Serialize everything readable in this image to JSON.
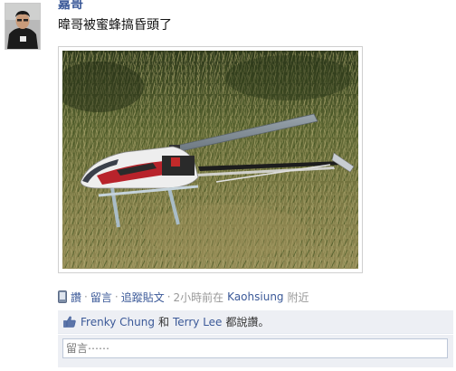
{
  "post": {
    "author": "嘉哥",
    "message": "暐哥被蜜蜂搞昏頭了"
  },
  "meta": {
    "like": "讚",
    "comment": "留言",
    "follow": "追蹤貼文",
    "time": "2小時前在",
    "location": "Kaohsiung",
    "near": "附近"
  },
  "likes": {
    "user1": "Frenky Chung",
    "and": "和",
    "user2": "Terry Lee",
    "suffix": "都說讚。"
  },
  "comment_box": {
    "placeholder": "留言⋯⋯"
  },
  "colors": {
    "link": "#3b5998",
    "muted": "#999999",
    "likes_bg": "#edeff4"
  },
  "icons": [
    "avatar-photo",
    "mobile-icon",
    "thumbs-up-icon"
  ]
}
